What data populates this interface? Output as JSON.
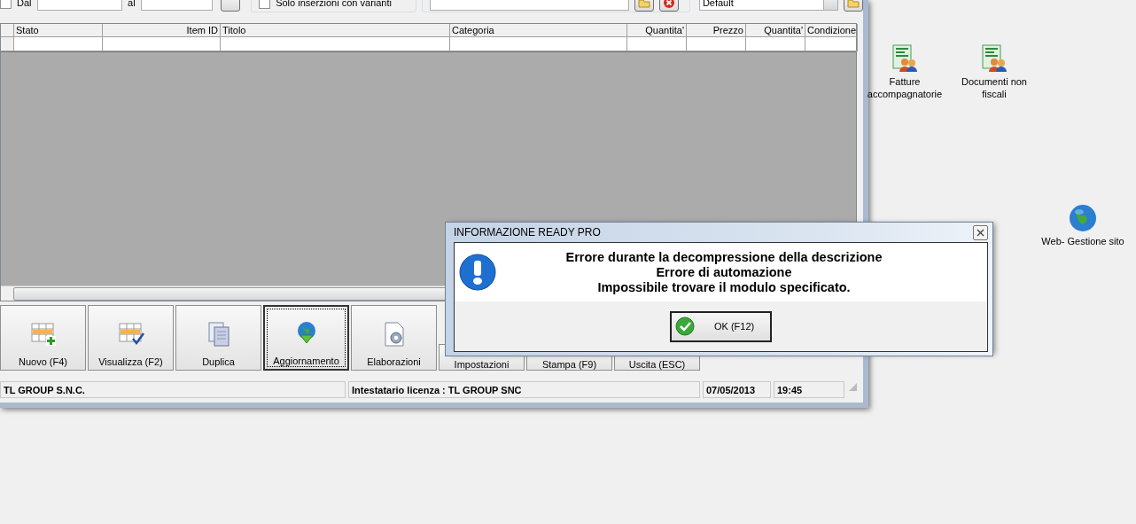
{
  "filter_bar": {
    "date_checkbox": {
      "checked": false
    },
    "date_from_label": "Dal",
    "date_to_label": "al",
    "variants_checkbox": {
      "label": "Solo inserzioni con varianti",
      "checked": false
    },
    "layout_dropdown": {
      "value": "Default"
    }
  },
  "table": {
    "columns": [
      {
        "label": "Stato"
      },
      {
        "label": "Item ID"
      },
      {
        "label": "Titolo"
      },
      {
        "label": "Categoria"
      },
      {
        "label": "Quantita'"
      },
      {
        "label": "Prezzo"
      },
      {
        "label": "Quantita'"
      },
      {
        "label": "Condizione"
      }
    ]
  },
  "toolbar": [
    {
      "label": "Nuovo (F4)",
      "kind": "large",
      "focused": false
    },
    {
      "label": "Visualizza (F2)",
      "kind": "large",
      "focused": false
    },
    {
      "label": "Duplica",
      "kind": "large",
      "focused": false
    },
    {
      "label": "Aggiornamento",
      "kind": "large",
      "focused": true
    },
    {
      "label": "Elaborazioni",
      "kind": "large",
      "focused": false
    },
    {
      "label": "Impostazioni",
      "kind": "small",
      "focused": false
    },
    {
      "label": "Stampa (F9)",
      "kind": "small",
      "focused": false
    },
    {
      "label": "Uscita (ESC)",
      "kind": "small",
      "focused": false
    }
  ],
  "status_bar": [
    "TL GROUP S.N.C.",
    "Intestatario licenza : TL GROUP SNC",
    "07/05/2013",
    "19:45"
  ],
  "desktop_icons": [
    {
      "label": "Fatture accompagnatorie",
      "kind": "document-people"
    },
    {
      "label": "Documenti non fiscali",
      "kind": "document-people"
    },
    {
      "label": "Web- Gestione sito",
      "kind": "globe"
    }
  ],
  "dialog": {
    "title": "INFORMAZIONE READY PRO",
    "message_lines": [
      "Errore durante la decompressione della descrizione",
      "Errore di automazione",
      "Impossibile trovare il modulo specificato."
    ],
    "ok_button": "OK (F12)"
  }
}
